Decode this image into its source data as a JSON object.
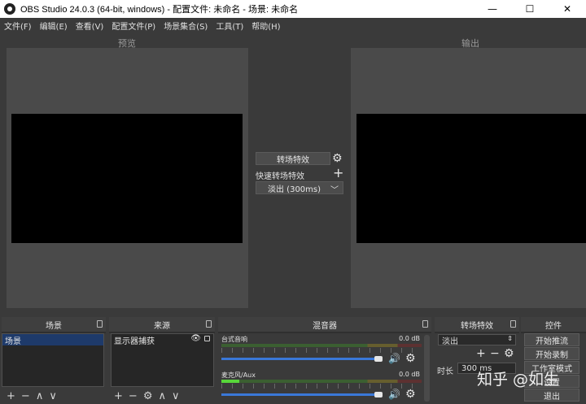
{
  "window": {
    "title": "OBS Studio 24.0.3 (64-bit, windows) - 配置文件: 未命名 - 场景: 未命名",
    "minimize": "—",
    "maximize": "☐",
    "close": "✕"
  },
  "menu": [
    "文件(F)",
    "编辑(E)",
    "查看(V)",
    "配置文件(P)",
    "场景集合(S)",
    "工具(T)",
    "帮助(H)"
  ],
  "preview": {
    "left_label": "预览",
    "right_label": "输出"
  },
  "studio_transition": {
    "button_label": "转场特效",
    "quick_label": "快速转场特效",
    "fade_label": "淡出 (300ms)",
    "gear_icon": "gear-icon",
    "plus_icon": "plus-icon",
    "chevron_icon": "chevron-down-icon"
  },
  "docks": {
    "scenes": {
      "title": "场景",
      "items": [
        "场景"
      ]
    },
    "sources": {
      "title": "来源",
      "items": [
        "显示器捕获"
      ]
    },
    "mixer": {
      "title": "混音器",
      "tracks": [
        {
          "name": "台式音响",
          "db": "0.0 dB",
          "volume": 1.0,
          "level": 0.0
        },
        {
          "name": "麦克风/Aux",
          "db": "0.0 dB",
          "volume": 1.0,
          "level": 0.09
        }
      ]
    },
    "transitions": {
      "title": "转场特效",
      "selected": "淡出",
      "duration_label": "时长",
      "duration_value": "300 ms"
    },
    "controls": {
      "title": "控件",
      "buttons": [
        "开始推流",
        "开始录制",
        "工作室模式",
        "设置",
        "退出"
      ]
    }
  },
  "watermark": "知乎 @如生",
  "colors": {
    "selection": "#1e3a6a",
    "slider": "#3a78d8",
    "meter_active": "#58d63a"
  }
}
